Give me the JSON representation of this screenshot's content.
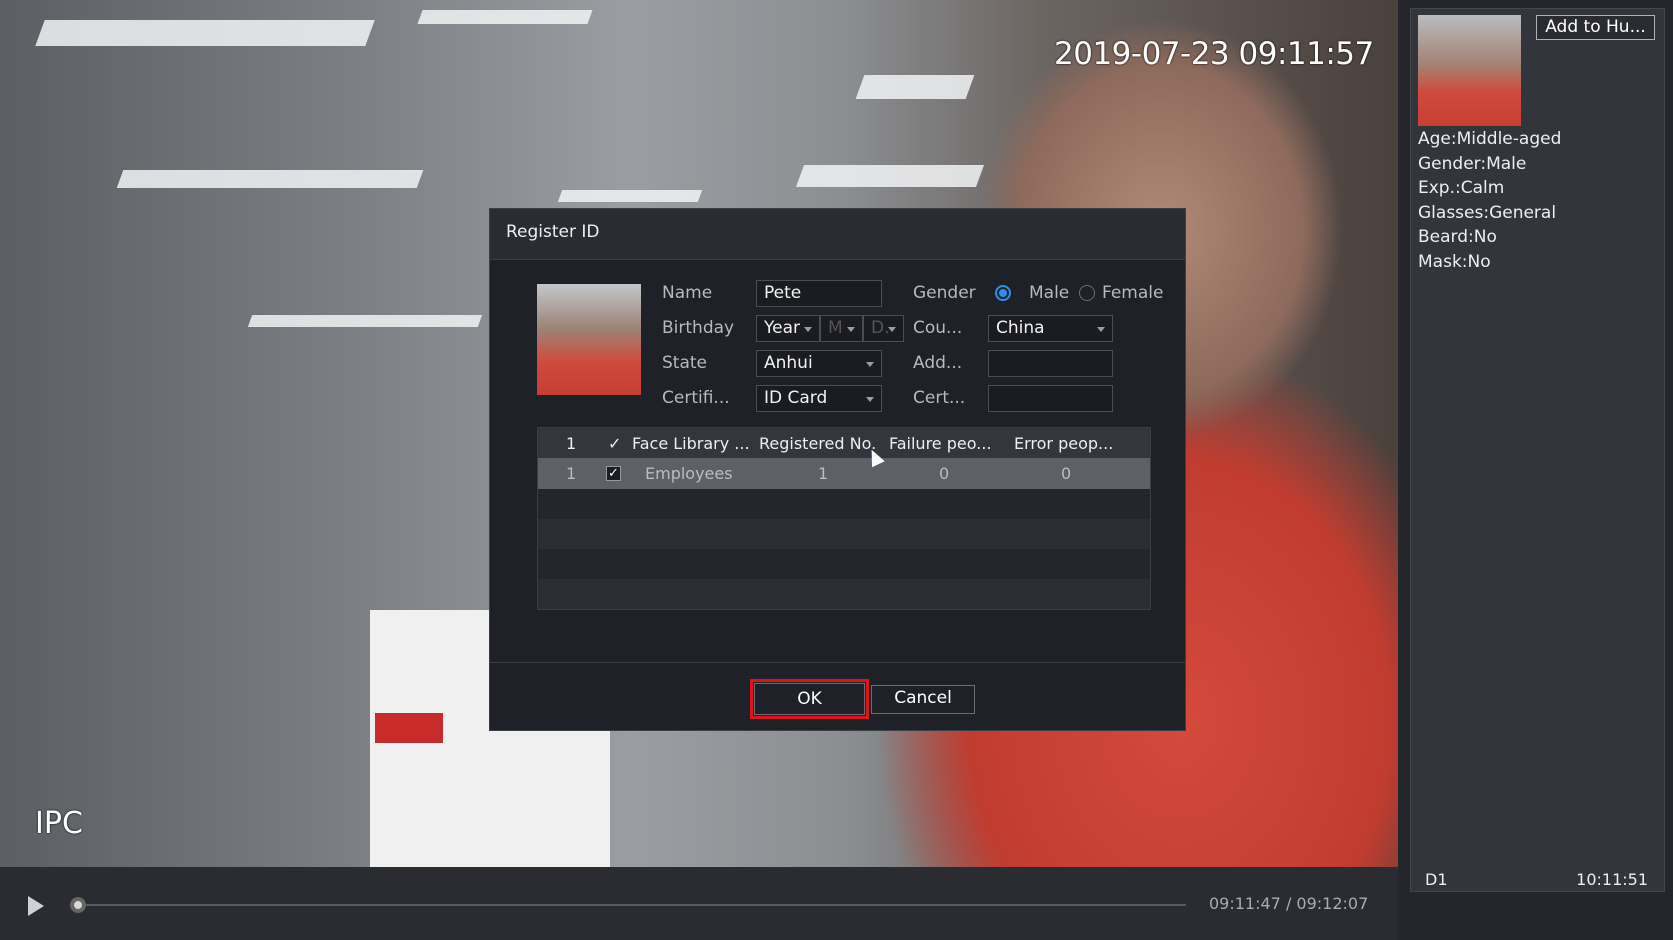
{
  "video": {
    "timestamp": "2019-07-23 09:11:57",
    "channel_label": "IPC",
    "playback_time": "09:11:47 / 09:12:07",
    "progress": 0.0
  },
  "right_panel": {
    "add_button": "Add to Hu...",
    "attributes": [
      "Age:Middle-aged",
      "Gender:Male",
      "Exp.:Calm",
      "Glasses:General",
      "Beard:No",
      "Mask:No"
    ],
    "channel": "D1",
    "time": "10:11:51"
  },
  "dialog": {
    "title": "Register ID",
    "fields": {
      "name_label": "Name",
      "name_value": "Pete",
      "gender_label": "Gender",
      "male": "Male",
      "female": "Female",
      "gender_selected": "Male",
      "birthday_label": "Birthday",
      "year": "Year",
      "month": "M",
      "day": "D.",
      "country_label": "Cou...",
      "country_value": "China",
      "state_label": "State",
      "state_value": "Anhui",
      "address_label": "Add...",
      "address_value": "",
      "cert_type_label": "Certifi...",
      "cert_type_value": "ID Card",
      "cert_no_label": "Cert...",
      "cert_no_value": ""
    },
    "table": {
      "headers": [
        "1",
        "✓",
        "Face Library ...",
        "Registered No.",
        "Failure peo...",
        "Error peop..."
      ],
      "rows": [
        {
          "index": "1",
          "checked": "✓",
          "library": "Employees",
          "registered": "1",
          "failure": "0",
          "error": "0"
        }
      ]
    },
    "ok": "OK",
    "cancel": "Cancel"
  },
  "colors": {
    "accent": "#2e8ff0",
    "highlight": "#e0131b"
  }
}
